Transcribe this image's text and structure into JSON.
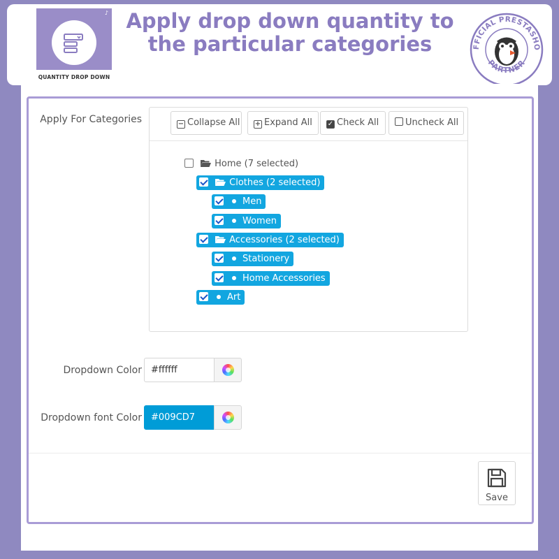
{
  "banner": {
    "title": "Apply drop down quantity to the particular categories",
    "logo_caption": "QUANTITY DROP DOWN",
    "partner_badge_lines": [
      "OFFICIAL PRESTASHOP",
      "PARTNER"
    ]
  },
  "form": {
    "categories_label": "Apply For Categories",
    "toolbar": {
      "collapse_all": "Collapse All",
      "expand_all": "Expand All",
      "check_all": "Check All",
      "uncheck_all": "Uncheck All"
    },
    "tree": {
      "root": {
        "label": "Home (7 selected)",
        "checked": false
      },
      "items": [
        {
          "label": "Clothes (2 selected)",
          "checked": true,
          "type": "folder"
        },
        {
          "label": "Men",
          "checked": true,
          "type": "leaf"
        },
        {
          "label": "Women",
          "checked": true,
          "type": "leaf"
        },
        {
          "label": "Accessories (2 selected)",
          "checked": true,
          "type": "folder"
        },
        {
          "label": "Stationery",
          "checked": true,
          "type": "leaf"
        },
        {
          "label": "Home Accessories",
          "checked": true,
          "type": "leaf"
        },
        {
          "label": "Art",
          "checked": true,
          "type": "leaf"
        }
      ]
    },
    "dropdown_color": {
      "label": "Dropdown Color",
      "value": "#ffffff"
    },
    "dropdown_font_color": {
      "label": "Dropdown font Color",
      "value": "#009CD7"
    },
    "save_label": "Save"
  },
  "colors": {
    "page_background": "#8f89c0",
    "accent_title": "#8a7cc0",
    "selected_node": "#12a6e0",
    "font_color_swatch": "#009CD7"
  },
  "icons": [
    "collapse-icon",
    "expand-icon",
    "check-all-icon",
    "uncheck-all-icon",
    "folder-open-icon",
    "color-wheel-icon",
    "save-floppy-icon",
    "prestashop-puffin-icon"
  ]
}
